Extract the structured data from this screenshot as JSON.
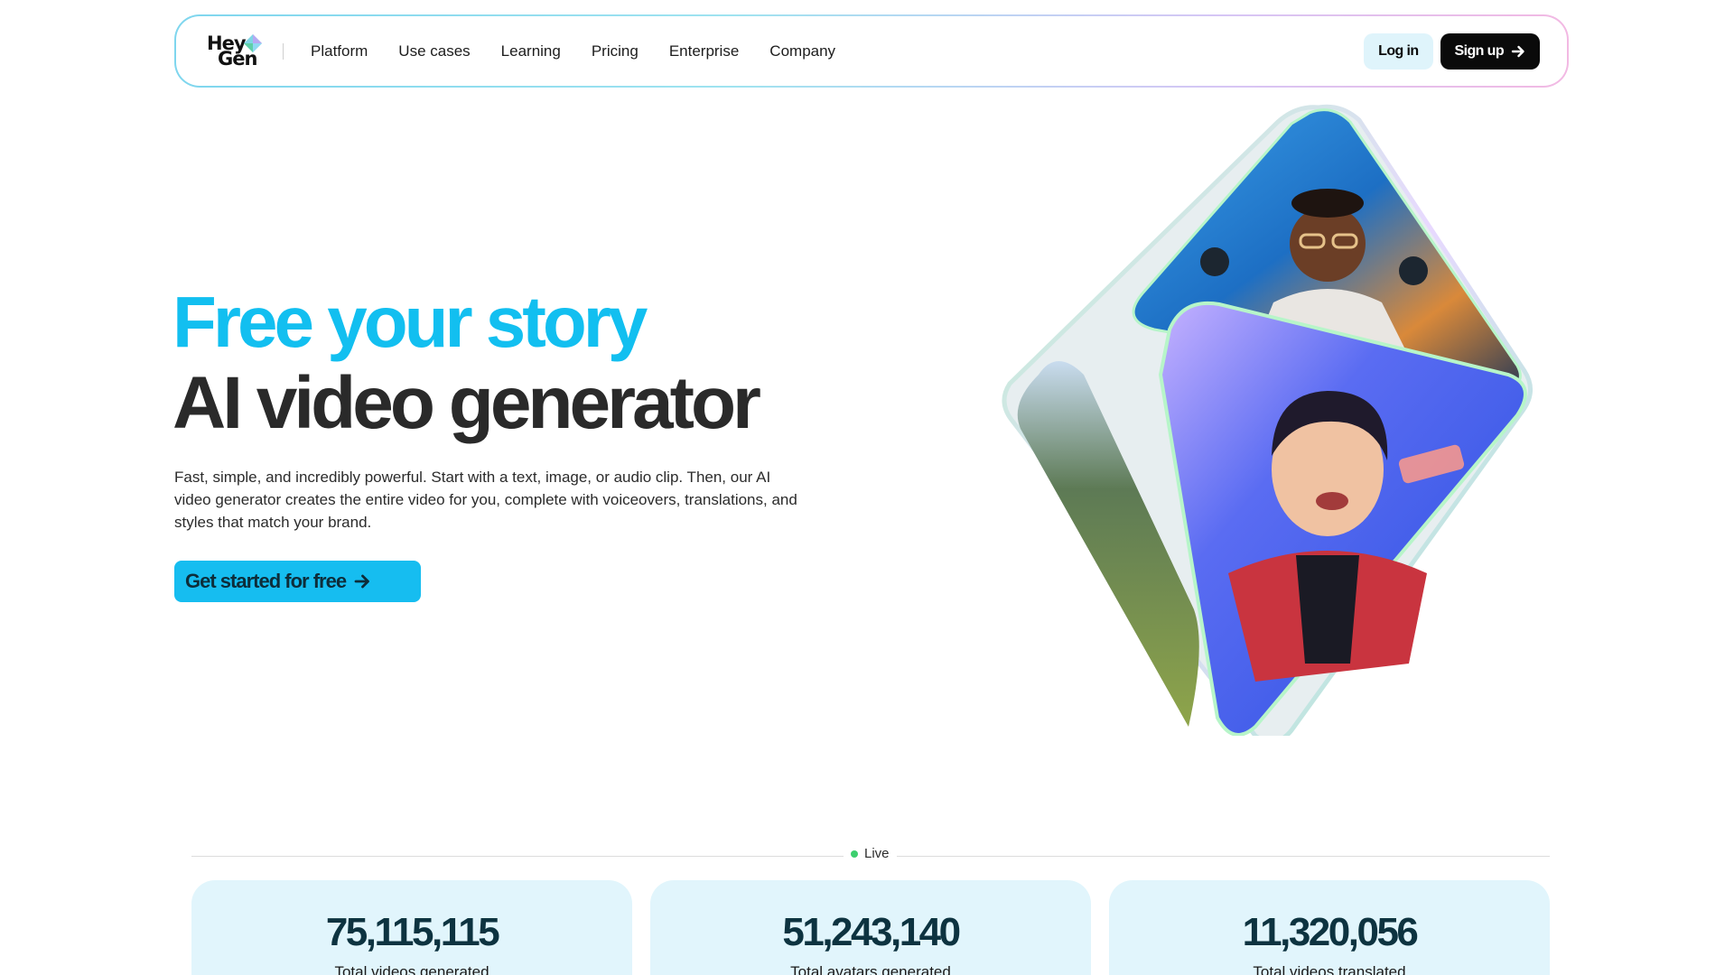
{
  "brand": {
    "logo_line1": "Hey",
    "logo_line2": "Gen"
  },
  "nav": {
    "links": [
      "Platform",
      "Use cases",
      "Learning",
      "Pricing",
      "Enterprise",
      "Company"
    ],
    "login_label": "Log in",
    "signup_label": "Sign up"
  },
  "hero": {
    "title_line1": "Free your story",
    "title_line2": "AI video generator",
    "description": "Fast, simple, and incredibly powerful. Start with a text, image, or audio clip. Then, our AI video generator creates the entire video for you, complete with voiceovers, translations, and styles that match your brand.",
    "cta_label": "Get started for free"
  },
  "live": {
    "label": "Live"
  },
  "stats": [
    {
      "value": "75,115,115",
      "label": "Total videos generated"
    },
    {
      "value": "51,243,140",
      "label": "Total avatars generated"
    },
    {
      "value": "11,320,056",
      "label": "Total videos translated"
    }
  ],
  "colors": {
    "accent": "#12bff0",
    "cta_bg": "#16bdf0",
    "stat_bg": "#e1f5fc",
    "live_dot": "#3ccf6e"
  },
  "icons": {
    "logo_mark": "heygen-diamond-icon",
    "signup_arrow": "arrow-right-icon",
    "cta_arrow": "arrow-right-icon"
  }
}
